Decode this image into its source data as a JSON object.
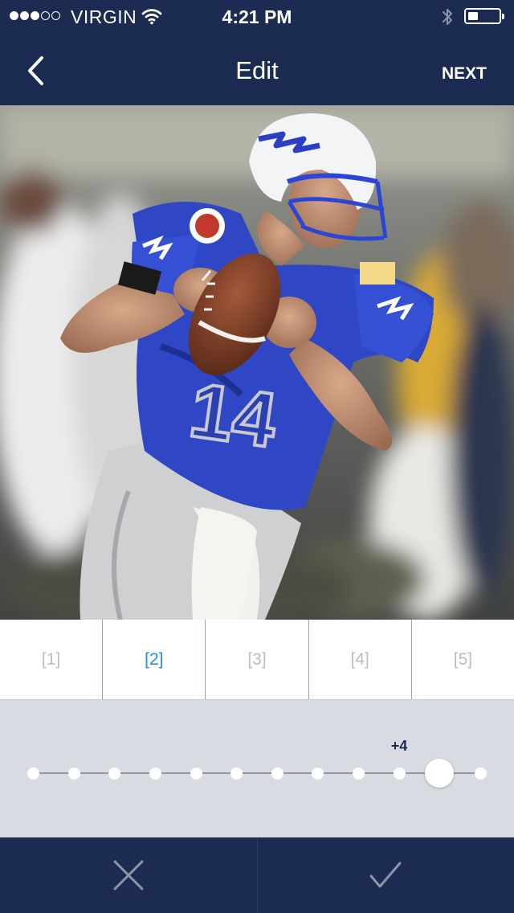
{
  "status_bar": {
    "carrier": "VIRGIN",
    "time": "4:21 PM",
    "signal_bars_filled": 3,
    "signal_bars_total": 5,
    "battery_level": 0.25,
    "icons": [
      "wifi-icon",
      "bluetooth-icon",
      "battery-icon"
    ]
  },
  "nav": {
    "title": "Edit",
    "next_label": "NEXT",
    "back_icon": "chevron-left-icon"
  },
  "photo": {
    "subject": "football-player-photo",
    "jersey_number": "14"
  },
  "filters": {
    "tabs": [
      {
        "label": "[1]"
      },
      {
        "label": "[2]"
      },
      {
        "label": "[3]"
      },
      {
        "label": "[4]"
      },
      {
        "label": "[5]"
      }
    ],
    "selected_index": 1
  },
  "adjust": {
    "value_label": "+4",
    "steps": 12,
    "selected_step": 10
  },
  "actions": {
    "cancel_icon": "close-icon",
    "confirm_icon": "checkmark-icon"
  },
  "colors": {
    "navy": "#1b2b52",
    "accent_blue": "#1e8ee8",
    "panel_gray": "#d8dbe1"
  }
}
